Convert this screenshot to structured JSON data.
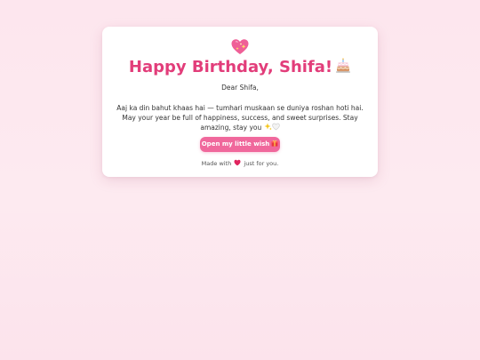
{
  "card": {
    "heart_icon": "sparkling-heart-icon",
    "title": "Happy Birthday, Shifa!",
    "title_icon": "birthday-cake-icon",
    "greeting": "Dear Shifa,",
    "message": "Aaj ka din bahut khaas hai — tumhari muskaan se duniya roshan hoti hai. May your year be full of happiness, success, and sweet surprises. Stay amazing, stay you",
    "message_icons": [
      "sparkles-icon",
      "white-heart-icon"
    ],
    "button_label": "Open my little wish",
    "button_icon": "gift-icon",
    "footer_prefix": "Made with",
    "footer_icon": "red-heart-icon",
    "footer_suffix": "just for you."
  },
  "colors": {
    "background": "#fde6ee",
    "card": "#ffffff",
    "title": "#e23d7a",
    "button": "#f0689c",
    "button_text": "#ffffff",
    "text": "#333333"
  }
}
